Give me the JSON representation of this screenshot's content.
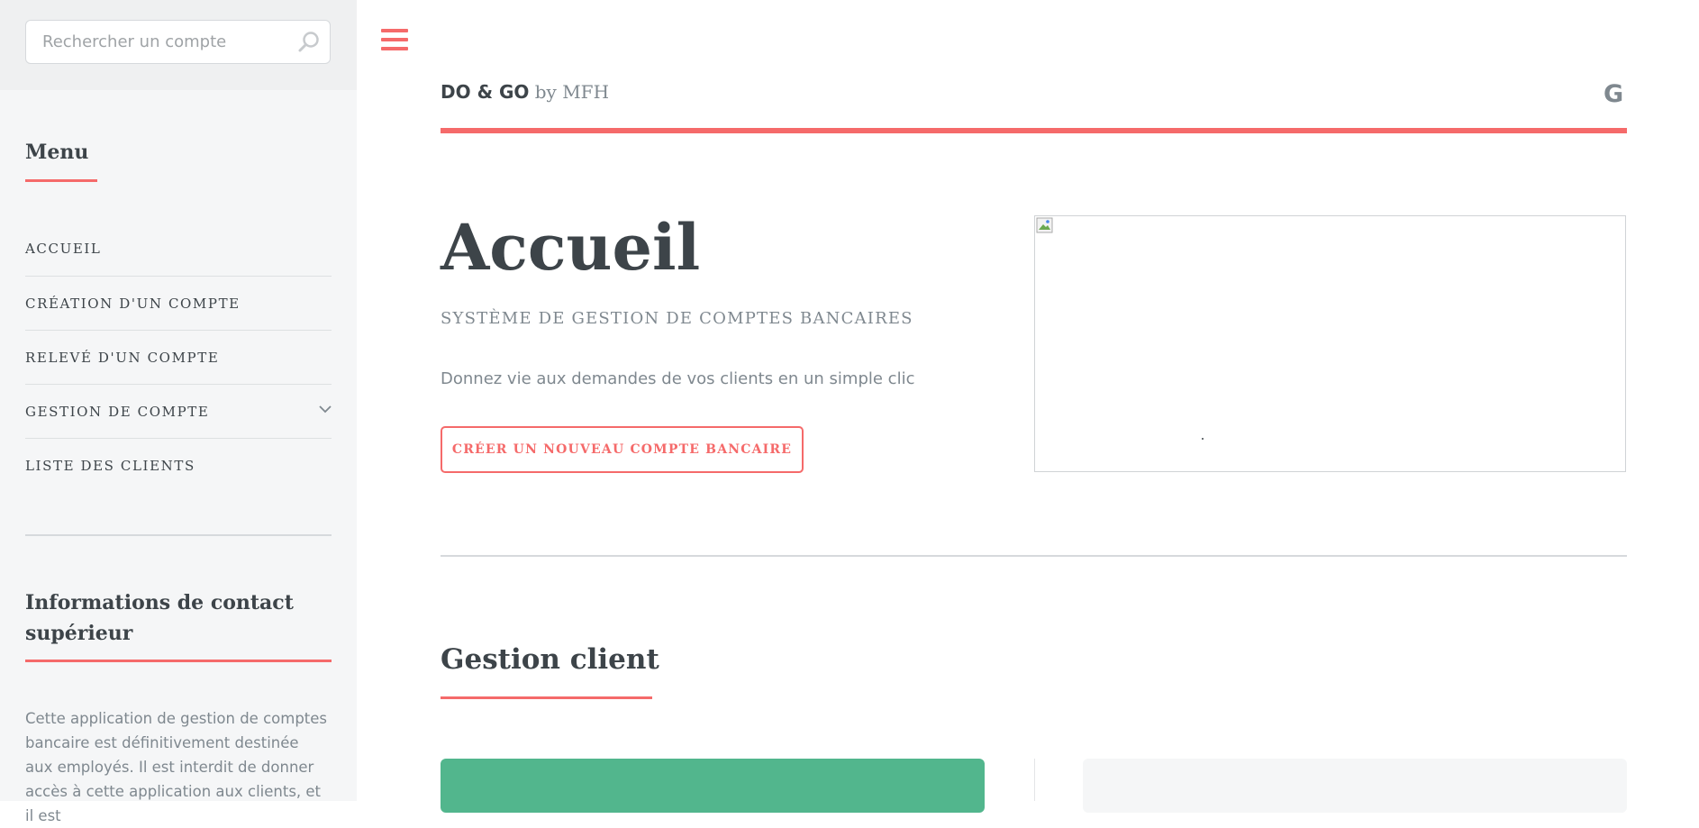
{
  "sidebar": {
    "search": {
      "placeholder": "Rechercher un compte",
      "value": "",
      "icon": "search-icon"
    },
    "menu_heading": "Menu",
    "menu_items": [
      {
        "label": "ACCUEIL"
      },
      {
        "label": "CRÉATION D'UN COMPTE"
      },
      {
        "label": "RELEVÉ D'UN COMPTE"
      },
      {
        "label": "GESTION DE COMPTE",
        "icon": "chevron-down-icon"
      },
      {
        "label": "LISTE DES CLIENTS"
      }
    ],
    "contact_heading": "Informations de contact supérieur",
    "contact_text": "Cette application de gestion de comptes bancaire est définitivement destinée aux employés. Il est interdit de donner accès à cette application aux clients, et il est"
  },
  "header": {
    "menu_icon": "hamburger-icon",
    "brand_strong": "DO & GO",
    "brand_rest": " by MFH",
    "social_icon": "google-icon",
    "social_glyph": "G"
  },
  "hero": {
    "title": "Accueil",
    "subtitle": "SYSTÈME DE GESTION DE COMPTES BANCAIRES",
    "intro": "Donnez vie aux demandes de vos clients en un simple clic",
    "cta_label": "CRÉER UN NOUVEAU COMPTE BANCAIRE",
    "image_icon": "broken-image-icon"
  },
  "section": {
    "title": "Gestion client"
  },
  "colors": {
    "accent": "#f56a6a",
    "text": "#3d4449",
    "muted": "#7f888f",
    "sidebar_bg": "#f5f6f7",
    "green_card": "#52b68d"
  }
}
